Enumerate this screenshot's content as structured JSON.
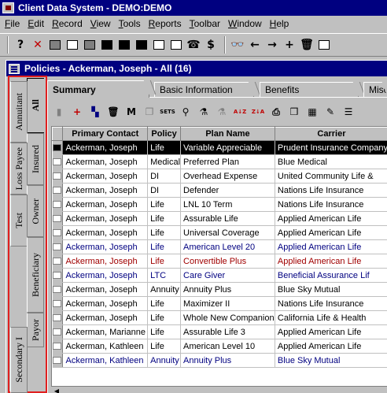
{
  "app": {
    "title": "Client Data System - DEMO:DEMO"
  },
  "menu": [
    "File",
    "Edit",
    "Record",
    "View",
    "Tools",
    "Reports",
    "Toolbar",
    "Window",
    "Help"
  ],
  "toolbar": {
    "help_glyph": "?",
    "close_glyph": "✕",
    "binoculars_glyph": "👓",
    "back_glyph": "←",
    "forward_glyph": "→",
    "add_glyph": "+",
    "delete_glyph": "🗑",
    "dollar_glyph": "$"
  },
  "window": {
    "title": "Policies - Ackerman, Joseph - All (16)"
  },
  "vertical_tabs": [
    "All",
    "Annuitant",
    "Insured",
    "Loss Payee",
    "Owner",
    "Test",
    "Beneficiary",
    "Payor",
    "Secondary I"
  ],
  "tabs": [
    "Summary",
    "Basic Information",
    "Benefits",
    "Misc."
  ],
  "grid_toolbar": {
    "sets_label": "SETS",
    "sort_asc": "A↓Z",
    "sort_desc": "Z↓A"
  },
  "columns": [
    "Primary Contact",
    "Policy",
    "Plan Name",
    "Carrier"
  ],
  "rows": [
    {
      "contact": "Ackerman, Joseph",
      "policy": "Life",
      "plan": "Variable Appreciable",
      "carrier": "Prudent Insurance Company",
      "style": "current"
    },
    {
      "contact": "Ackerman, Joseph",
      "policy": "Medical",
      "plan": "Preferred Plan",
      "carrier": "Blue Medical",
      "style": ""
    },
    {
      "contact": "Ackerman, Joseph",
      "policy": "DI",
      "plan": "Overhead Expense",
      "carrier": "United Community Life &",
      "style": ""
    },
    {
      "contact": "Ackerman, Joseph",
      "policy": "DI",
      "plan": "Defender",
      "carrier": "Nations Life Insurance",
      "style": ""
    },
    {
      "contact": "Ackerman, Joseph",
      "policy": "Life",
      "plan": "LNL 10 Term",
      "carrier": "Nations Life Insurance",
      "style": ""
    },
    {
      "contact": "Ackerman, Joseph",
      "policy": "Life",
      "plan": "Assurable Life",
      "carrier": "Applied American Life",
      "style": ""
    },
    {
      "contact": "Ackerman, Joseph",
      "policy": "Life",
      "plan": "Universal Coverage",
      "carrier": "Applied American Life",
      "style": ""
    },
    {
      "contact": "Ackerman, Joseph",
      "policy": "Life",
      "plan": "American Level 20",
      "carrier": "Applied American Life",
      "style": "blue"
    },
    {
      "contact": "Ackerman, Joseph",
      "policy": "Life",
      "plan": "Convertible Plus",
      "carrier": "Applied American Life",
      "style": "red"
    },
    {
      "contact": "Ackerman, Joseph",
      "policy": "LTC",
      "plan": "Care Giver",
      "carrier": "Beneficial Assurance Lif",
      "style": "blue"
    },
    {
      "contact": "Ackerman, Joseph",
      "policy": "Annuity",
      "plan": "Annuity Plus",
      "carrier": "Blue Sky Mutual",
      "style": ""
    },
    {
      "contact": "Ackerman, Joseph",
      "policy": "Life",
      "plan": "Maximizer II",
      "carrier": "Nations Life Insurance",
      "style": ""
    },
    {
      "contact": "Ackerman, Joseph",
      "policy": "Life",
      "plan": "Whole New Companion",
      "carrier": "California Life & Health",
      "style": ""
    },
    {
      "contact": "Ackerman, Marianne",
      "policy": "Life",
      "plan": "Assurable Life 3",
      "carrier": "Applied American Life",
      "style": ""
    },
    {
      "contact": "Ackerman, Kathleen",
      "policy": "Life",
      "plan": "American Level 10",
      "carrier": "Applied American Life",
      "style": ""
    },
    {
      "contact": "Ackerman, Kathleen",
      "policy": "Annuity",
      "plan": "Annuity Plus",
      "carrier": "Blue Sky Mutual",
      "style": "blue"
    }
  ],
  "colors": {
    "titlebar": "#000080",
    "highlight_border": "#e02020",
    "selected_row": "#000000"
  }
}
